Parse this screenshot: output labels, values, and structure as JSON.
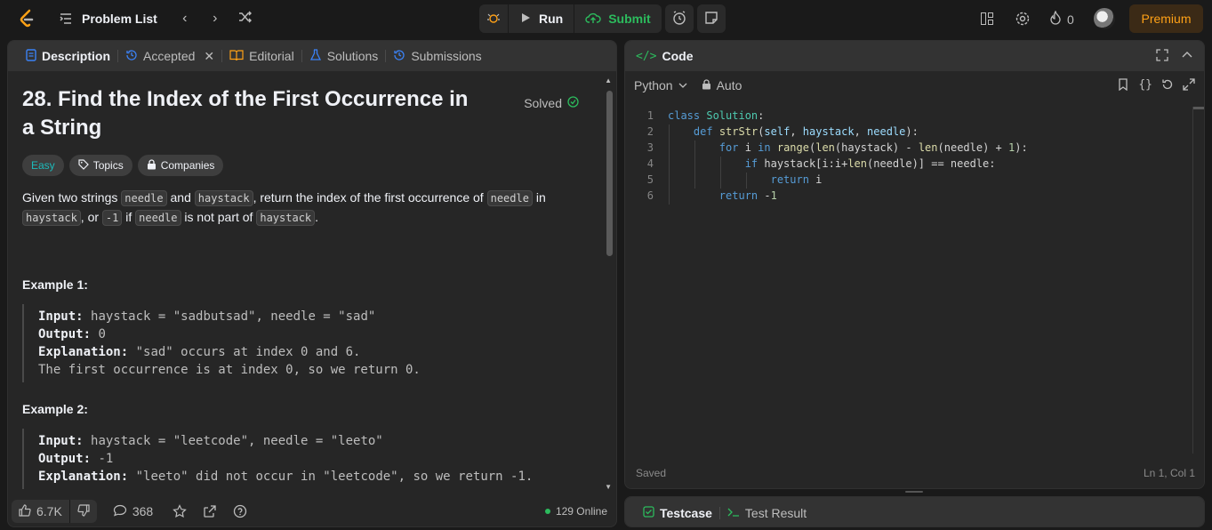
{
  "topbar": {
    "title": "Problem List",
    "run_label": "Run",
    "submit_label": "Submit",
    "streak_count": "0",
    "premium_label": "Premium"
  },
  "left_tabs": {
    "description": "Description",
    "accepted": "Accepted",
    "editorial": "Editorial",
    "solutions": "Solutions",
    "submissions": "Submissions"
  },
  "problem": {
    "title": "28. Find the Index of the First Occurrence in a String",
    "status": "Solved",
    "difficulty": "Easy",
    "topics_label": "Topics",
    "companies_label": "Companies",
    "statement": {
      "t1": "Given two strings ",
      "c1": "needle",
      "t2": " and ",
      "c2": "haystack",
      "t3": ", return the index of the first occurrence of ",
      "c3": "needle",
      "t4": " in ",
      "c4": "haystack",
      "t5": ", or ",
      "c5": "-1",
      "t6": " if ",
      "c6": "needle",
      "t7": " is not part of ",
      "c7": "haystack",
      "t8": "."
    },
    "examples": [
      {
        "title": "Example 1:",
        "input_label": "Input:",
        "input": "haystack = \"sadbutsad\", needle = \"sad\"",
        "output_label": "Output:",
        "output": "0",
        "explanation_label": "Explanation:",
        "explanation": "\"sad\" occurs at index 0 and 6.",
        "explanation_2": "The first occurrence is at index 0, so we return 0."
      },
      {
        "title": "Example 2:",
        "input_label": "Input:",
        "input": "haystack = \"leetcode\", needle = \"leeto\"",
        "output_label": "Output:",
        "output": "-1",
        "explanation_label": "Explanation:",
        "explanation": "\"leeto\" did not occur in \"leetcode\", so we return -1."
      }
    ]
  },
  "left_footer": {
    "likes": "6.7K",
    "comments": "368",
    "online": "129 Online"
  },
  "code_panel": {
    "title": "Code",
    "language": "Python",
    "mode": "Auto",
    "status": "Saved",
    "cursor": "Ln 1, Col 1"
  },
  "code_lines": [
    "1",
    "2",
    "3",
    "4",
    "5",
    "6"
  ],
  "test_panel": {
    "testcase_label": "Testcase",
    "result_label": "Test Result"
  },
  "colors": {
    "accent": "#ffa116",
    "submit_green": "#2cbb5d",
    "easy": "#1cbaba"
  }
}
